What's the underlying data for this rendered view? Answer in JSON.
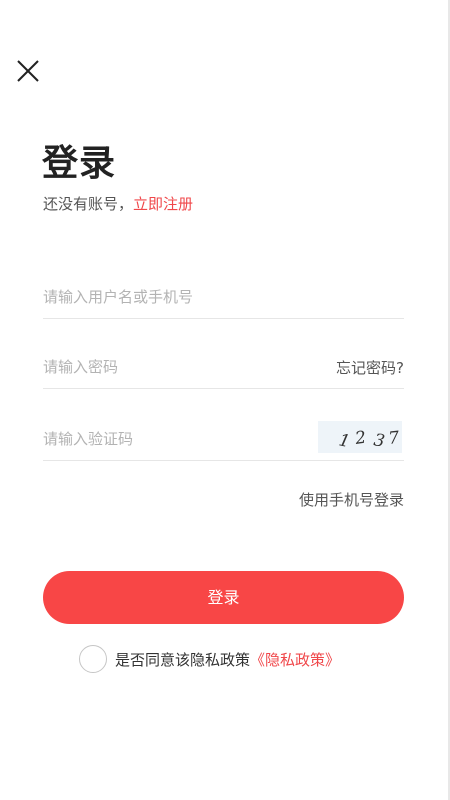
{
  "header": {
    "close_icon": "close-icon"
  },
  "page": {
    "title": "登录",
    "subtitle_prefix": "还没有账号，",
    "register_link": "立即注册"
  },
  "form": {
    "username_placeholder": "请输入用户名或手机号",
    "password_placeholder": "请输入密码",
    "forgot_password": "忘记密码?",
    "captcha_placeholder": "请输入验证码",
    "captcha_code": "1237",
    "phone_login": "使用手机号登录"
  },
  "actions": {
    "login_label": "登录"
  },
  "agreement": {
    "text": "是否同意该隐私政策",
    "policy_link": "《隐私政策》",
    "checked": false
  },
  "colors": {
    "accent": "#f84646",
    "link": "#f0474a"
  }
}
